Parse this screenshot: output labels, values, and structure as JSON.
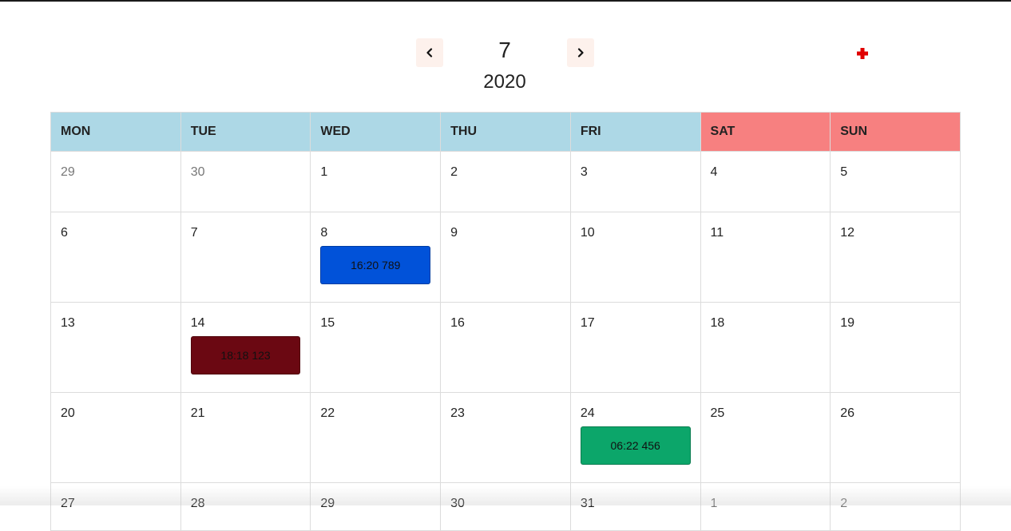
{
  "header": {
    "month": "7",
    "year": "2020",
    "prev_icon": "chevron-left-icon",
    "next_icon": "chevron-right-icon",
    "add_icon": "plus-icon"
  },
  "colors": {
    "weekday_header": "#add8e6",
    "weekend_header": "#f78080",
    "nav_button": "#fdf1ec",
    "add_icon": "#e00000"
  },
  "weekdays": [
    "MON",
    "TUE",
    "WED",
    "THU",
    "FRI",
    "SAT",
    "SUN"
  ],
  "weeks": [
    [
      {
        "day": "29",
        "muted": true
      },
      {
        "day": "30",
        "muted": true
      },
      {
        "day": "1"
      },
      {
        "day": "2"
      },
      {
        "day": "3"
      },
      {
        "day": "4"
      },
      {
        "day": "5"
      }
    ],
    [
      {
        "day": "6"
      },
      {
        "day": "7"
      },
      {
        "day": "8",
        "event": {
          "label": "16:20 789",
          "color": "#0152d9"
        }
      },
      {
        "day": "9"
      },
      {
        "day": "10"
      },
      {
        "day": "11"
      },
      {
        "day": "12"
      }
    ],
    [
      {
        "day": "13"
      },
      {
        "day": "14",
        "event": {
          "label": "18:18 123",
          "color": "#6b0812"
        }
      },
      {
        "day": "15"
      },
      {
        "day": "16"
      },
      {
        "day": "17"
      },
      {
        "day": "18"
      },
      {
        "day": "19"
      }
    ],
    [
      {
        "day": "20"
      },
      {
        "day": "21"
      },
      {
        "day": "22"
      },
      {
        "day": "23"
      },
      {
        "day": "24",
        "event": {
          "label": "06:22 456",
          "color": "#0ca66a"
        }
      },
      {
        "day": "25"
      },
      {
        "day": "26"
      }
    ],
    [
      {
        "day": "27"
      },
      {
        "day": "28"
      },
      {
        "day": "29"
      },
      {
        "day": "30"
      },
      {
        "day": "31"
      },
      {
        "day": "1",
        "muted": true
      },
      {
        "day": "2",
        "muted": true
      }
    ]
  ]
}
